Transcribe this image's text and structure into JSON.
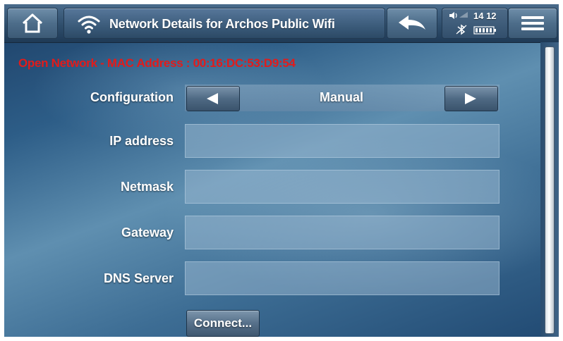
{
  "header": {
    "title": "Network Details for Archos Public Wifi",
    "time": "14 12",
    "icons": [
      "home-icon",
      "wifi-icon",
      "back-icon",
      "volume-icon",
      "bluetooth-icon",
      "battery-icon",
      "menu-icon"
    ]
  },
  "info": {
    "text": "Open Network - MAC Address : 00:16:DC:53:D9:54",
    "color": "#e21b1b"
  },
  "form": {
    "configuration": {
      "label": "Configuration",
      "value": "Manual"
    },
    "ip_address": {
      "label": "IP address",
      "value": ""
    },
    "netmask": {
      "label": "Netmask",
      "value": ""
    },
    "gateway": {
      "label": "Gateway",
      "value": ""
    },
    "dns_server": {
      "label": "DNS Server",
      "value": ""
    }
  },
  "actions": {
    "connect_label": "Connect..."
  }
}
